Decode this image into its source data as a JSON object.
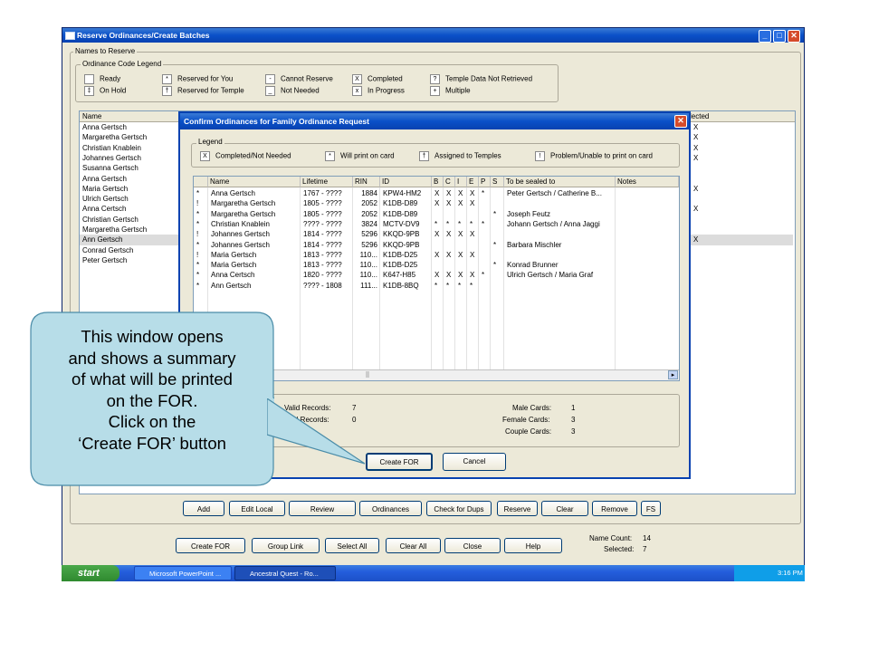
{
  "window": {
    "title": "Reserve Ordinances/Create Batches"
  },
  "names_group": {
    "label": "Names to Reserve"
  },
  "legend_group": {
    "label": "Ordinance Code Legend",
    "items": [
      {
        "symbol": "",
        "label": "Ready"
      },
      {
        "symbol": "*",
        "label": "Reserved for You"
      },
      {
        "symbol": "-",
        "label": "Cannot Reserve"
      },
      {
        "symbol": "X",
        "label": "Completed"
      },
      {
        "symbol": "?",
        "label": "Temple Data Not Retrieved"
      },
      {
        "symbol": "‡",
        "label": "On Hold"
      },
      {
        "symbol": "†",
        "label": "Reserved for Temple"
      },
      {
        "symbol": "_",
        "label": "Not Needed"
      },
      {
        "symbol": "x",
        "label": "In Progress"
      },
      {
        "symbol": "+",
        "label": "Multiple"
      }
    ]
  },
  "names_list": {
    "header": "Name",
    "selected_header": "lected",
    "rows": [
      {
        "name": "Anna Gertsch",
        "sel": "X"
      },
      {
        "name": "Margaretha Gertsch",
        "sel": "X"
      },
      {
        "name": "Christian Knablein",
        "sel": "X"
      },
      {
        "name": "Johannes Gertsch",
        "sel": "X"
      },
      {
        "name": "Susanna Gertsch",
        "sel": ""
      },
      {
        "name": "Anna Gertsch",
        "sel": ""
      },
      {
        "name": "Maria Gertsch",
        "sel": "X"
      },
      {
        "name": "Ulrich Gertsch",
        "sel": ""
      },
      {
        "name": "Anna Certsch",
        "sel": "X"
      },
      {
        "name": "Christian Gertsch",
        "sel": ""
      },
      {
        "name": "Margaretha Gertsch",
        "sel": ""
      },
      {
        "name": "Ann Gertsch",
        "sel": "X"
      },
      {
        "name": "Conrad Gertsch",
        "sel": ""
      },
      {
        "name": "Peter Gertsch",
        "sel": ""
      }
    ]
  },
  "main_buttons_row1": [
    "Add",
    "Edit Local",
    "Review",
    "Ordinances",
    "Check for Dups",
    "Reserve",
    "Clear",
    "Remove",
    "FS"
  ],
  "main_buttons_row2": [
    "Create FOR",
    "Group Link",
    "Select All",
    "Clear All",
    "Close",
    "Help"
  ],
  "counts": {
    "name_count_label": "Name Count:",
    "name_count": "14",
    "selected_label": "Selected:",
    "selected": "7"
  },
  "dialog": {
    "title": "Confirm Ordinances for Family Ordinance Request",
    "legend_label": "Legend",
    "legend": [
      {
        "symbol": "X",
        "label": "Completed/Not Needed"
      },
      {
        "symbol": "*",
        "label": "Will print on card"
      },
      {
        "symbol": "†",
        "label": "Assigned to Temples"
      },
      {
        "symbol": "!",
        "label": "Problem/Unable to print on card"
      }
    ],
    "columns": [
      "",
      "Name",
      "Lifetime",
      "RIN",
      "ID",
      "B",
      "C",
      "I",
      "E",
      "P",
      "S",
      "To be sealed to",
      "Notes"
    ],
    "rows": [
      [
        "*",
        "Anna Gertsch",
        "1767 - ????",
        "1884",
        "KPW4-HM2",
        "X",
        "X",
        "X",
        "X",
        "*",
        "",
        "Peter Gertsch / Catherine B...",
        ""
      ],
      [
        "!",
        "Margaretha Gertsch",
        "1805 - ????",
        "2052",
        "K1DB-D89",
        "X",
        "X",
        "X",
        "X",
        "",
        "",
        "",
        ""
      ],
      [
        "*",
        "Margaretha Gertsch",
        "1805 - ????",
        "2052",
        "K1DB-D89",
        "",
        "",
        "",
        "",
        "",
        "*",
        "Joseph Feutz",
        ""
      ],
      [
        "*",
        "Christian Knablein",
        "???? - ????",
        "3824",
        "MCTV-DV9",
        "*",
        "*",
        "*",
        "*",
        "*",
        "",
        "Johann Gertsch / Anna Jaggi",
        ""
      ],
      [
        "!",
        "Johannes Gertsch",
        "1814 - ????",
        "5296",
        "KKQD-9PB",
        "X",
        "X",
        "X",
        "X",
        "",
        "",
        "",
        ""
      ],
      [
        "*",
        "Johannes Gertsch",
        "1814 - ????",
        "5296",
        "KKQD-9PB",
        "",
        "",
        "",
        "",
        "",
        "*",
        "Barbara Mischler",
        ""
      ],
      [
        "!",
        "Maria Gertsch",
        "1813 - ????",
        "110...",
        "K1DB-D25",
        "X",
        "X",
        "X",
        "X",
        "",
        "",
        "",
        ""
      ],
      [
        "*",
        "Maria Gertsch",
        "1813 - ????",
        "110...",
        "K1DB-D25",
        "",
        "",
        "",
        "",
        "",
        "*",
        "Konrad Brunner",
        ""
      ],
      [
        "*",
        "Anna Certsch",
        "1820 - ????",
        "110...",
        "K647-H85",
        "X",
        "X",
        "X",
        "X",
        "*",
        "",
        "Ulrich Gertsch / Maria Graf",
        ""
      ],
      [
        "*",
        "Ann Gertsch",
        "???? - 1808",
        "111...",
        "K1DB-8BQ",
        "*",
        "*",
        "*",
        "*",
        "",
        "",
        "",
        ""
      ]
    ],
    "summary": {
      "valid_label": "Valid Records:",
      "valid": "7",
      "invalid_label": "alid Records:",
      "invalid": "0",
      "male_label": "Male Cards:",
      "male": "1",
      "female_label": "Female Cards:",
      "female": "3",
      "couple_label": "Couple Cards:",
      "couple": "3"
    },
    "create_button": "Create FOR",
    "cancel_button": "Cancel"
  },
  "taskbar": {
    "start": "start",
    "tasks": [
      "Microsoft PowerPoint ...",
      "Ancestral Quest - Ro..."
    ],
    "clock": "3:16 PM"
  },
  "callout": {
    "text_lines": [
      "This window opens",
      "and shows a summary",
      "of what will be printed",
      "on the FOR.",
      "Click on the",
      "‘Create FOR’ button"
    ],
    "fill": "#b7dde8",
    "stroke": "#4a8ca8"
  }
}
